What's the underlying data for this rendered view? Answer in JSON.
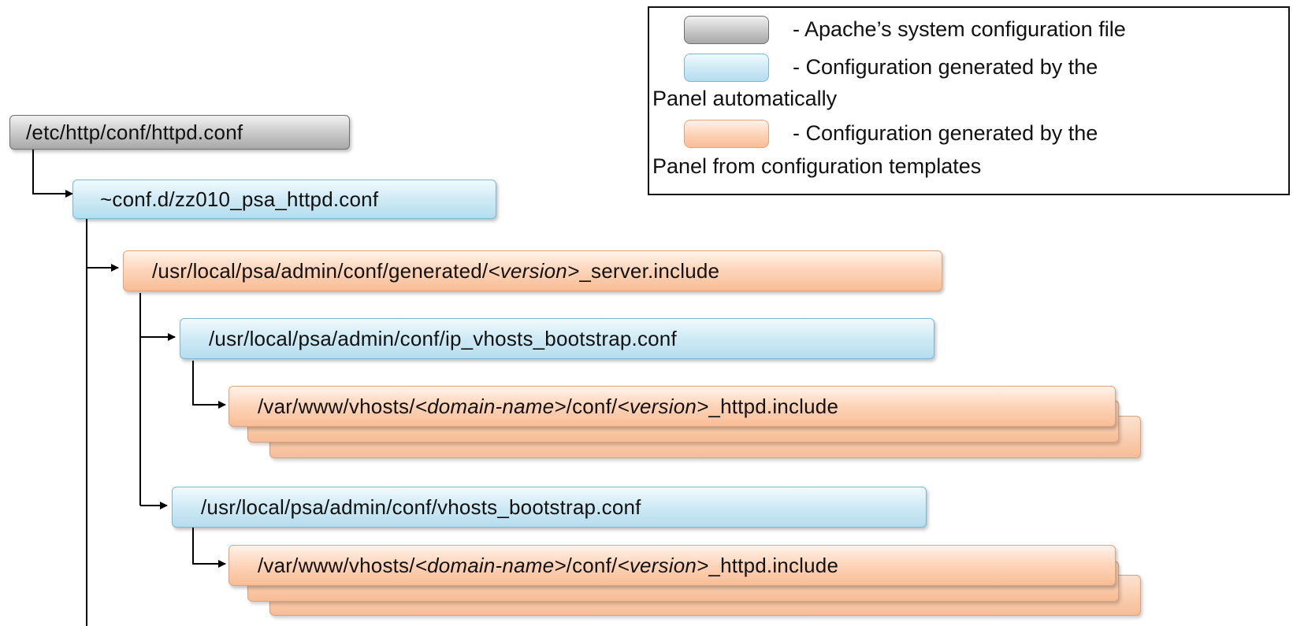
{
  "legend": {
    "items": [
      {
        "swatch": "gray",
        "color": "#b8b8b8",
        "line1": "- Apache’s system configuration file",
        "line2": ""
      },
      {
        "swatch": "blue",
        "color": "#c6e5f2",
        "line1": "- Configuration generated by the",
        "line2": "Panel automatically"
      },
      {
        "swatch": "peach",
        "color": "#fbc9a6",
        "line1": "- Configuration generated by the",
        "line2": "Panel from configuration templates"
      }
    ]
  },
  "nodes": {
    "root": {
      "text": "/etc/http/conf/httpd.conf"
    },
    "psa_httpd": {
      "text": "~conf.d/zz010_psa_httpd.conf"
    },
    "server_include": {
      "prefix": "/usr/local/psa/admin/conf/generated/",
      "var": "<version>",
      "suffix": "_server.include"
    },
    "ip_vhosts": {
      "text": "/usr/local/psa/admin/conf/ip_vhosts_bootstrap.conf"
    },
    "vhost_include_1": {
      "p1": "/var/www/vhosts/",
      "v1": "<domain-name>",
      "p2": "/conf/",
      "v2": "<version>",
      "p3": "_httpd.include"
    },
    "vhosts": {
      "text": "/usr/local/psa/admin/conf/vhosts_bootstrap.conf"
    },
    "vhost_include_2": {
      "p1": "/var/www/vhosts/",
      "v1": "<domain-name>",
      "p2": "/conf/",
      "v2": "<version>",
      "p3": "_httpd.include"
    }
  },
  "colors": {
    "gray": "#b8b8b8",
    "blue": "#c6e5f2",
    "peach": "#fbc9a6",
    "connector": "#000000"
  }
}
